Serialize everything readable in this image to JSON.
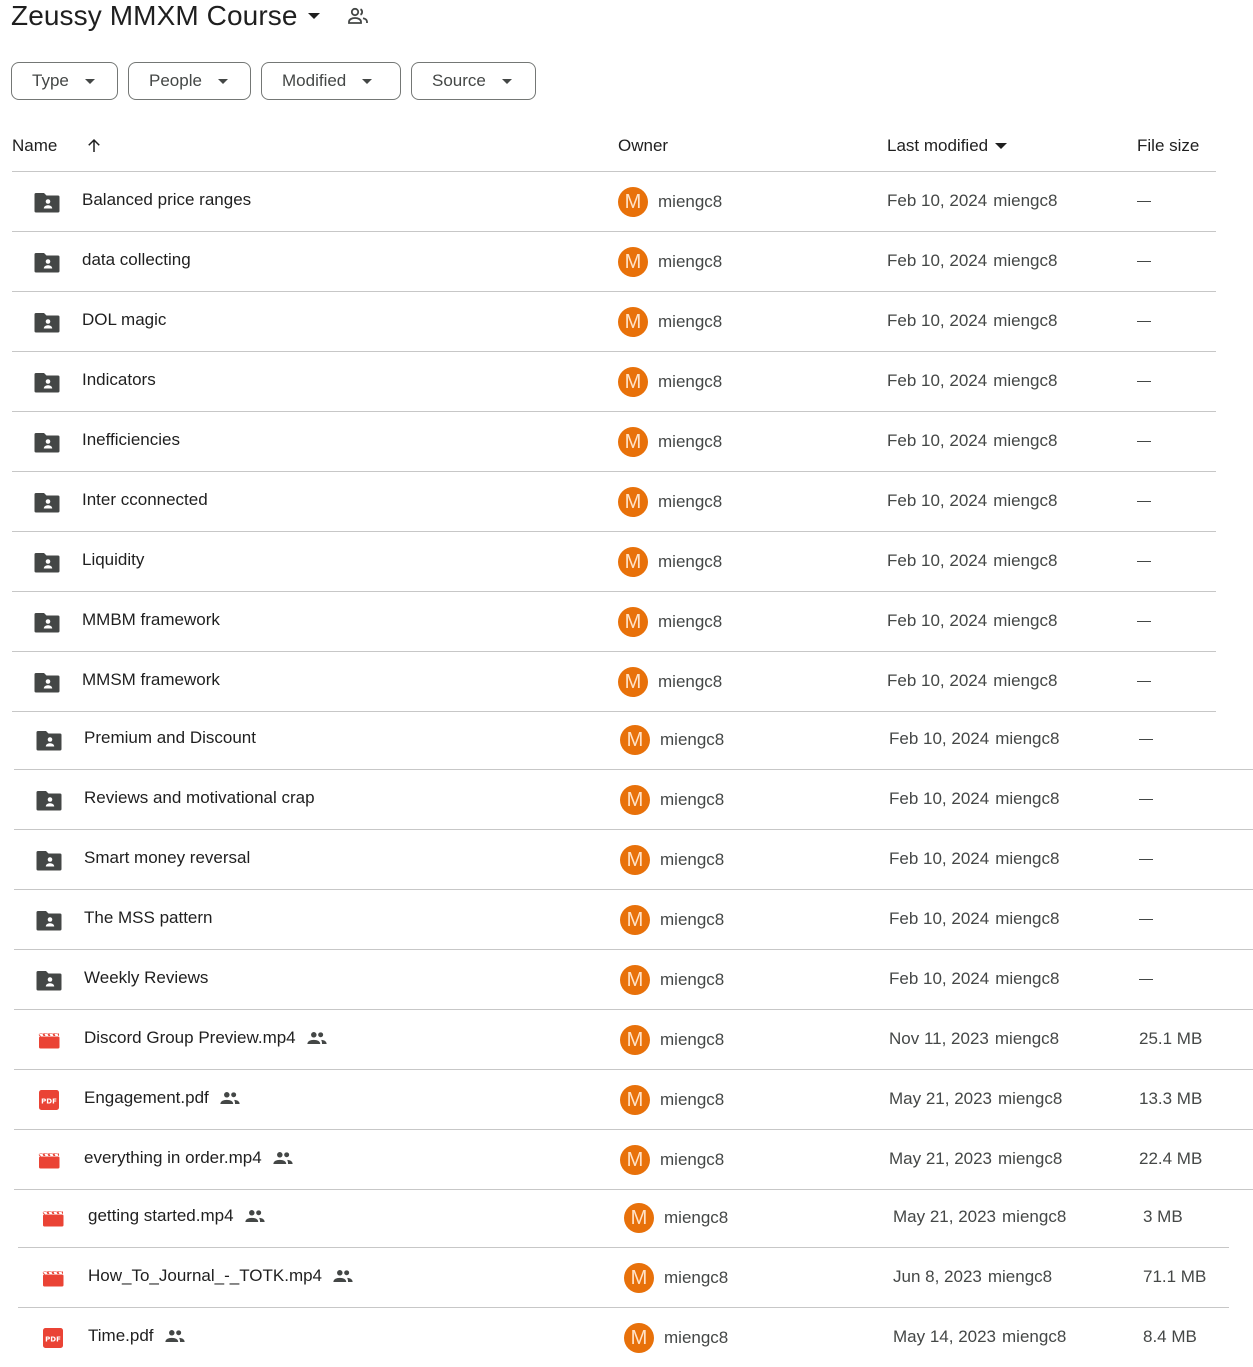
{
  "title": {
    "text": "Zeussy MMXM Course",
    "caret_icon": "arrow-drop-down-icon",
    "share_icon": "manage-people-icon"
  },
  "filters": [
    {
      "label": "Type"
    },
    {
      "label": "People"
    },
    {
      "label": "Modified"
    },
    {
      "label": "Source"
    }
  ],
  "columns": {
    "name": "Name",
    "name_sort_icon": "arrow-upward-icon",
    "owner": "Owner",
    "last_modified": "Last modified",
    "last_modified_sort_icon": "arrow-drop-down-icon",
    "file_size": "File size"
  },
  "colors": {
    "avatar_bg": "#e8710a",
    "folder_icon": "#444746",
    "file_icon_red": "#ea4335",
    "divider": "#c7c7c7"
  },
  "rows": [
    {
      "name": "Balanced price ranges",
      "type": "shared-folder",
      "shared": false,
      "owner_initial": "M",
      "owner": "miengc8",
      "modified_date": "Feb 10, 2024",
      "modified_by": "miengc8",
      "size": "—"
    },
    {
      "name": "data collecting",
      "type": "shared-folder",
      "shared": false,
      "owner_initial": "M",
      "owner": "miengc8",
      "modified_date": "Feb 10, 2024",
      "modified_by": "miengc8",
      "size": "—"
    },
    {
      "name": "DOL magic",
      "type": "shared-folder",
      "shared": false,
      "owner_initial": "M",
      "owner": "miengc8",
      "modified_date": "Feb 10, 2024",
      "modified_by": "miengc8",
      "size": "—"
    },
    {
      "name": "Indicators",
      "type": "shared-folder",
      "shared": false,
      "owner_initial": "M",
      "owner": "miengc8",
      "modified_date": "Feb 10, 2024",
      "modified_by": "miengc8",
      "size": "—"
    },
    {
      "name": "Inefficiencies",
      "type": "shared-folder",
      "shared": false,
      "owner_initial": "M",
      "owner": "miengc8",
      "modified_date": "Feb 10, 2024",
      "modified_by": "miengc8",
      "size": "—"
    },
    {
      "name": "Inter cconnected",
      "type": "shared-folder",
      "shared": false,
      "owner_initial": "M",
      "owner": "miengc8",
      "modified_date": "Feb 10, 2024",
      "modified_by": "miengc8",
      "size": "—"
    },
    {
      "name": "Liquidity",
      "type": "shared-folder",
      "shared": false,
      "owner_initial": "M",
      "owner": "miengc8",
      "modified_date": "Feb 10, 2024",
      "modified_by": "miengc8",
      "size": "—"
    },
    {
      "name": "MMBM framework",
      "type": "shared-folder",
      "shared": false,
      "owner_initial": "M",
      "owner": "miengc8",
      "modified_date": "Feb 10, 2024",
      "modified_by": "miengc8",
      "size": "—"
    },
    {
      "name": "MMSM framework",
      "type": "shared-folder",
      "shared": false,
      "owner_initial": "M",
      "owner": "miengc8",
      "modified_date": "Feb 10, 2024",
      "modified_by": "miengc8",
      "size": "—"
    },
    {
      "name": "Premium and Discount",
      "type": "shared-folder",
      "shared": false,
      "owner_initial": "M",
      "owner": "miengc8",
      "modified_date": "Feb 10, 2024",
      "modified_by": "miengc8",
      "size": "—"
    },
    {
      "name": "Reviews and motivational crap",
      "type": "shared-folder",
      "shared": false,
      "owner_initial": "M",
      "owner": "miengc8",
      "modified_date": "Feb 10, 2024",
      "modified_by": "miengc8",
      "size": "—"
    },
    {
      "name": "Smart money reversal",
      "type": "shared-folder",
      "shared": false,
      "owner_initial": "M",
      "owner": "miengc8",
      "modified_date": "Feb 10, 2024",
      "modified_by": "miengc8",
      "size": "—"
    },
    {
      "name": "The MSS pattern",
      "type": "shared-folder",
      "shared": false,
      "owner_initial": "M",
      "owner": "miengc8",
      "modified_date": "Feb 10, 2024",
      "modified_by": "miengc8",
      "size": "—"
    },
    {
      "name": "Weekly Reviews",
      "type": "shared-folder",
      "shared": false,
      "owner_initial": "M",
      "owner": "miengc8",
      "modified_date": "Feb 10, 2024",
      "modified_by": "miengc8",
      "size": "—"
    },
    {
      "name": "Discord Group Preview.mp4",
      "type": "video",
      "shared": true,
      "owner_initial": "M",
      "owner": "miengc8",
      "modified_date": "Nov 11, 2023",
      "modified_by": "miengc8",
      "size": "25.1 MB"
    },
    {
      "name": "Engagement.pdf",
      "type": "pdf",
      "shared": true,
      "owner_initial": "M",
      "owner": "miengc8",
      "modified_date": "May 21, 2023",
      "modified_by": "miengc8",
      "size": "13.3 MB"
    },
    {
      "name": "everything in order.mp4",
      "type": "video",
      "shared": true,
      "owner_initial": "M",
      "owner": "miengc8",
      "modified_date": "May 21, 2023",
      "modified_by": "miengc8",
      "size": "22.4 MB"
    },
    {
      "name": "getting started.mp4",
      "type": "video",
      "shared": true,
      "owner_initial": "M",
      "owner": "miengc8",
      "modified_date": "May 21, 2023",
      "modified_by": "miengc8",
      "size": "3 MB"
    },
    {
      "name": "How_To_Journal_-_TOTK.mp4",
      "type": "video",
      "shared": true,
      "owner_initial": "M",
      "owner": "miengc8",
      "modified_date": "Jun 8, 2023",
      "modified_by": "miengc8",
      "size": "71.1 MB"
    },
    {
      "name": "Time.pdf",
      "type": "pdf",
      "shared": true,
      "owner_initial": "M",
      "owner": "miengc8",
      "modified_date": "May 14, 2023",
      "modified_by": "miengc8",
      "size": "8.4 MB"
    }
  ]
}
